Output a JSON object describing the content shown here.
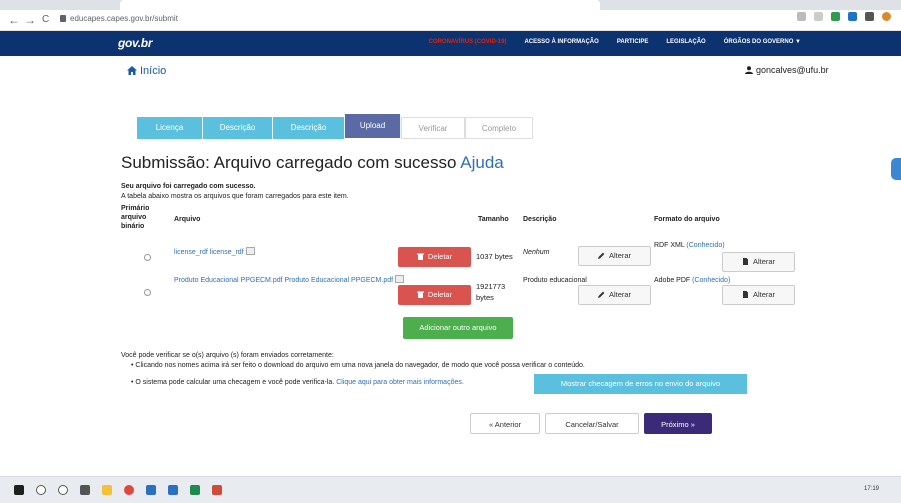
{
  "browser": {
    "url": "educapes.capes.gov.br/submit",
    "back": "←",
    "forward": "→",
    "reload": "C"
  },
  "gov": {
    "logo": "gov.br",
    "links": [
      "CORONAVÍRUS (COVID-19)",
      "ACESSO À INFORMAÇÃO",
      "PARTICIPE",
      "LEGISLAÇÃO",
      "ÓRGÃOS DO GOVERNO ▼"
    ]
  },
  "header": {
    "home": "Início",
    "user": "goncalves@ufu.br"
  },
  "steps": [
    {
      "label": "Licença"
    },
    {
      "label": "Descrição"
    },
    {
      "label": "Descrição"
    },
    {
      "label": "Upload"
    },
    {
      "label": "Verificar"
    },
    {
      "label": "Completo"
    }
  ],
  "main": {
    "title": "Submissão: Arquivo carregado com sucesso",
    "help": "Ajuda",
    "success_msg": "Seu arquivo foi carregado com sucesso.",
    "table_desc": "A tabela abaixo mostra os arquivos que foram carregados para este item."
  },
  "table": {
    "headers": {
      "primary": "Primário arquivo binário",
      "file": "Arquivo",
      "size": "Tamanho",
      "desc": "Descrição",
      "format": "Formato do arquivo"
    },
    "rows": [
      {
        "file": "license_rdf license_rdf",
        "delete": "Deletar",
        "size": "1037 bytes",
        "desc": "Nenhum",
        "alter_desc": "Alterar",
        "format": "RDF XML",
        "known": "(Conhecido)",
        "alter_format": "Alterar"
      },
      {
        "file": "Produto Educacional PPGECM.pdf Produto Educacional PPGECM.pdf",
        "delete": "Deletar",
        "size": "1921773 bytes",
        "desc": "Produto educacional",
        "alter_desc": "Alterar",
        "format": "Adobe PDF",
        "known": "(Conhecido)",
        "alter_format": "Alterar"
      }
    ],
    "add_button": "Adicionar outro arquivo"
  },
  "verify": {
    "intro": "Você pode verificar se o(s) arquivo (s) foram enviados corretamente:",
    "bullet1": "Clicando nos nomes acima irá ser feito o download do arquivo em uma nova janela do navegador, de modo que você possa verificar o conteúdo.",
    "bullet2": "O sistema pode calcular uma checagem e você pode verifica-la.",
    "bullet2_link": "Clique aqui para obter mais informações.",
    "check_button": "Mostrar checagem de erros no envio do arquivo"
  },
  "nav": {
    "previous": "« Anterior",
    "cancel": "Cancelar/Salvar",
    "next": "Próximo »"
  },
  "taskbar": {
    "clock": "17:19"
  }
}
